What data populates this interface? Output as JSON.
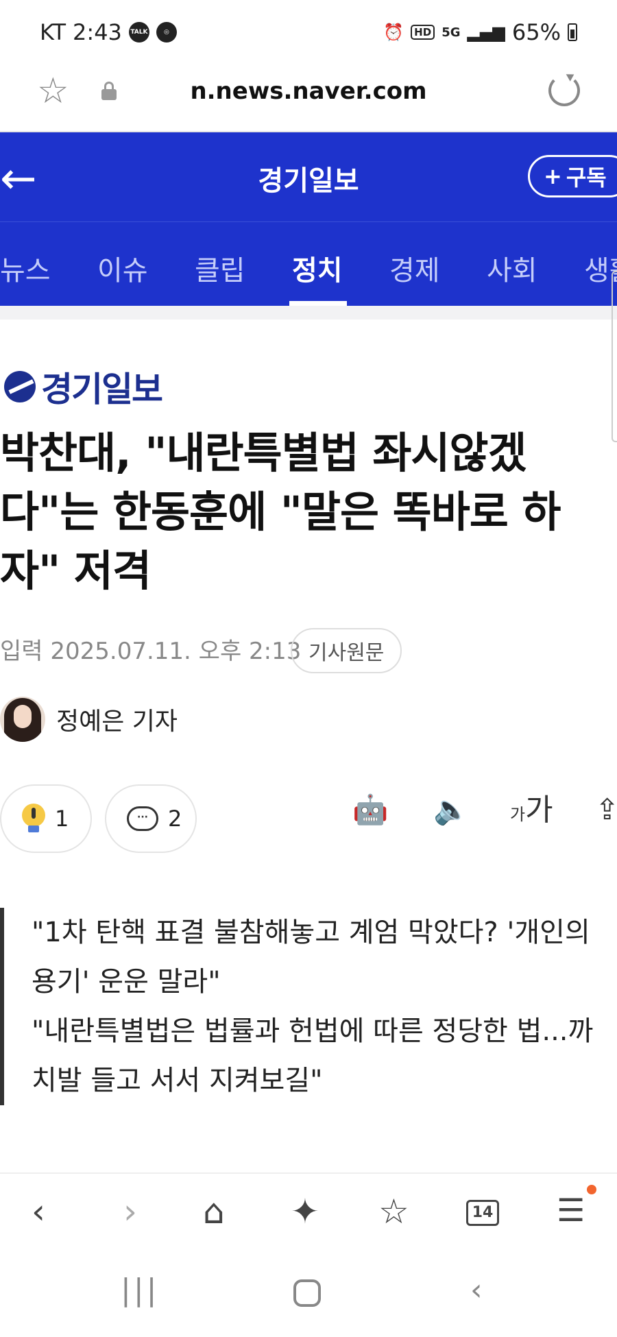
{
  "status_bar": {
    "carrier": "KT",
    "time": "2:43",
    "talk_label": "TALK",
    "hd_label": "HD",
    "network": "5G",
    "battery": "65%"
  },
  "url_bar": {
    "url": "n.news.naver.com"
  },
  "header": {
    "title": "경기일보",
    "subscribe_label": "구독"
  },
  "tabs": [
    {
      "label": "뉴스"
    },
    {
      "label": "이슈"
    },
    {
      "label": "클립"
    },
    {
      "label": "정치",
      "active": true
    },
    {
      "label": "경제"
    },
    {
      "label": "사회"
    },
    {
      "label": "생활"
    }
  ],
  "article": {
    "publisher": "경기일보",
    "headline": "박찬대, \"내란특별법 좌시않겠다\"는 한동훈에 \"말은 똑바로 하자\" 저격",
    "date_label": "입력",
    "date": "2025.07.11. 오후 2:13",
    "original_button": "기사원문",
    "author": "정예은 기자",
    "like_count": "1",
    "comment_count": "2",
    "font_small": "가",
    "font_large": "가",
    "summary": [
      "\"1차 탄핵 표결 불참해놓고 계엄 막았다? '개인의 용기' 운운 말라\"",
      "\"내란특별법은 법률과 헌법에 따른 정당한 법...까치발 들고 서서 지켜보길\""
    ]
  },
  "browser_bar": {
    "tab_count": "14"
  },
  "colors": {
    "brand_blue": "#1e33cc",
    "logo_navy": "#1c2f8f",
    "notification": "#f2652e"
  }
}
